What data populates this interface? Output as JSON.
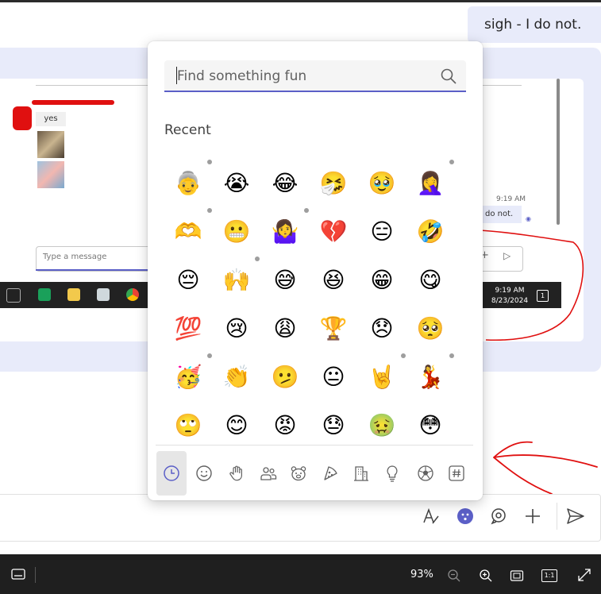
{
  "chat": {
    "sent_message": "sigh - I do not."
  },
  "inner_screenshot": {
    "yes_text": "yes",
    "time_label": "9:19 AM",
    "sent_snippet": "do not.",
    "type_placeholder": "Type a message",
    "taskbar_time": "9:19 AM",
    "taskbar_date": "8/23/2024",
    "notif_count": "1"
  },
  "emoji_picker": {
    "search_placeholder": "Find something fun",
    "section_label": "Recent",
    "emojis": [
      [
        "👵",
        "😭",
        "😂",
        "🤧",
        "🥹",
        "🤦‍♀️"
      ],
      [
        "🫶",
        "😬",
        "🤷‍♀️",
        "💔",
        "😑",
        "🤣"
      ],
      [
        "😔",
        "🙌",
        "😅",
        "😆",
        "😁",
        "😋"
      ],
      [
        "💯",
        "😢",
        "😩",
        "🏆",
        "😞",
        "🥺"
      ],
      [
        "🥳",
        "👏",
        "🫤",
        "😐",
        "🤘",
        "💃"
      ],
      [
        "🙄",
        "😊",
        "😡",
        "😓",
        "🤢",
        "😳"
      ]
    ],
    "categories": [
      "recent",
      "smileys",
      "hands",
      "people",
      "animals",
      "food",
      "buildings",
      "objects",
      "activities",
      "symbols"
    ]
  },
  "colors": {
    "accent": "#5b5fc7",
    "band": "#e8ebfa",
    "annotation_red": "#e01010"
  },
  "statusbar": {
    "zoom": "93%",
    "ratio_label": "1:1"
  }
}
